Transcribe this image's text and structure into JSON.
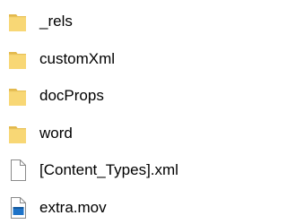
{
  "colors": {
    "folder": "#f8d775",
    "folder_dark": "#e3b94d",
    "document_border": "#8a8a8a",
    "video_accent": "#1e73c8"
  },
  "items": [
    {
      "name": "_rels",
      "type": "folder",
      "icon": "folder-icon"
    },
    {
      "name": "customXml",
      "type": "folder",
      "icon": "folder-icon"
    },
    {
      "name": "docProps",
      "type": "folder",
      "icon": "folder-icon"
    },
    {
      "name": "word",
      "type": "folder",
      "icon": "folder-icon"
    },
    {
      "name": "[Content_Types].xml",
      "type": "file",
      "icon": "document-icon"
    },
    {
      "name": "extra.mov",
      "type": "file",
      "icon": "video-file-icon"
    }
  ]
}
